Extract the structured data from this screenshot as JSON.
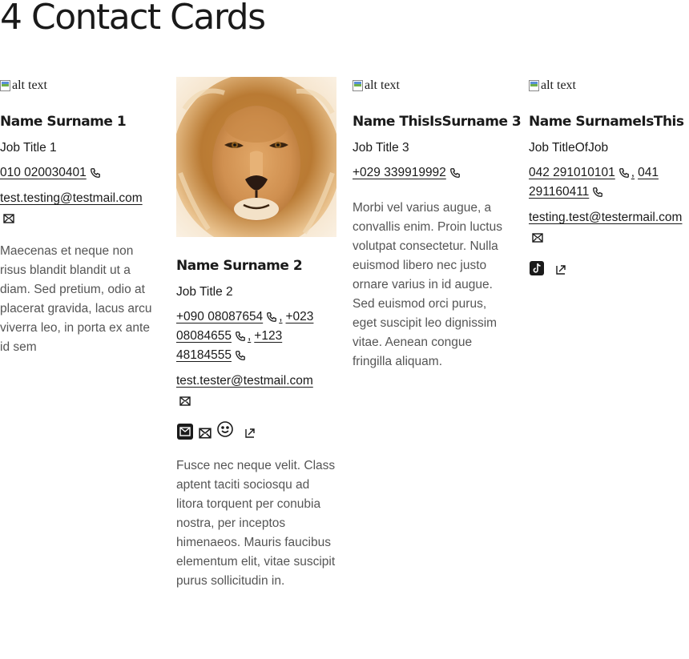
{
  "page": {
    "title": "4 Contact Cards"
  },
  "alt_text": "alt text",
  "cards": [
    {
      "name": "Name Surname 1",
      "job": "Job Title 1",
      "phones": [
        "010 020030401"
      ],
      "email": "test.testing@testmail.com",
      "description": "Maecenas et neque non risus blandit blandit ut a diam. Sed pretium, odio at placerat gravida, lacus arcu viverra leo, in porta ex ante id sem"
    },
    {
      "name": "Name Surname 2",
      "job": "Job Title 2",
      "phones": [
        "+090 08087654",
        "+023 08084655",
        "+123 48184555"
      ],
      "separator": ",",
      "email": "test.tester@testmail.com",
      "socials": [
        "mail-square-icon",
        "mail-icon",
        "smiley-icon",
        "external-link-icon"
      ],
      "description": "Fusce nec neque velit. Class aptent taciti sociosqu ad litora torquent per conubia nostra, per inceptos himenaeos. Mauris faucibus elementum elit, vitae suscipit purus sollicitudin in."
    },
    {
      "name": "Name ThisIsSurname 3",
      "job": "Job Title 3",
      "phones": [
        "+029 339919992"
      ],
      "description": "Morbi vel varius augue, a convallis enim. Proin luctus volutpat consectetur. Nulla euismod libero nec justo ornare varius in id augue. Sed euismod orci purus, eget suscipit leo dignissim vitae. Aenean congue fringilla aliquam."
    },
    {
      "name": "Name SurnameIsThis",
      "job": "Job TitleOfJob",
      "phones": [
        "042 291010101",
        "041 291160411"
      ],
      "separator": ",",
      "email": "testing.test@testermail.com",
      "socials": [
        "tiktok-icon",
        "external-link-icon"
      ]
    }
  ]
}
